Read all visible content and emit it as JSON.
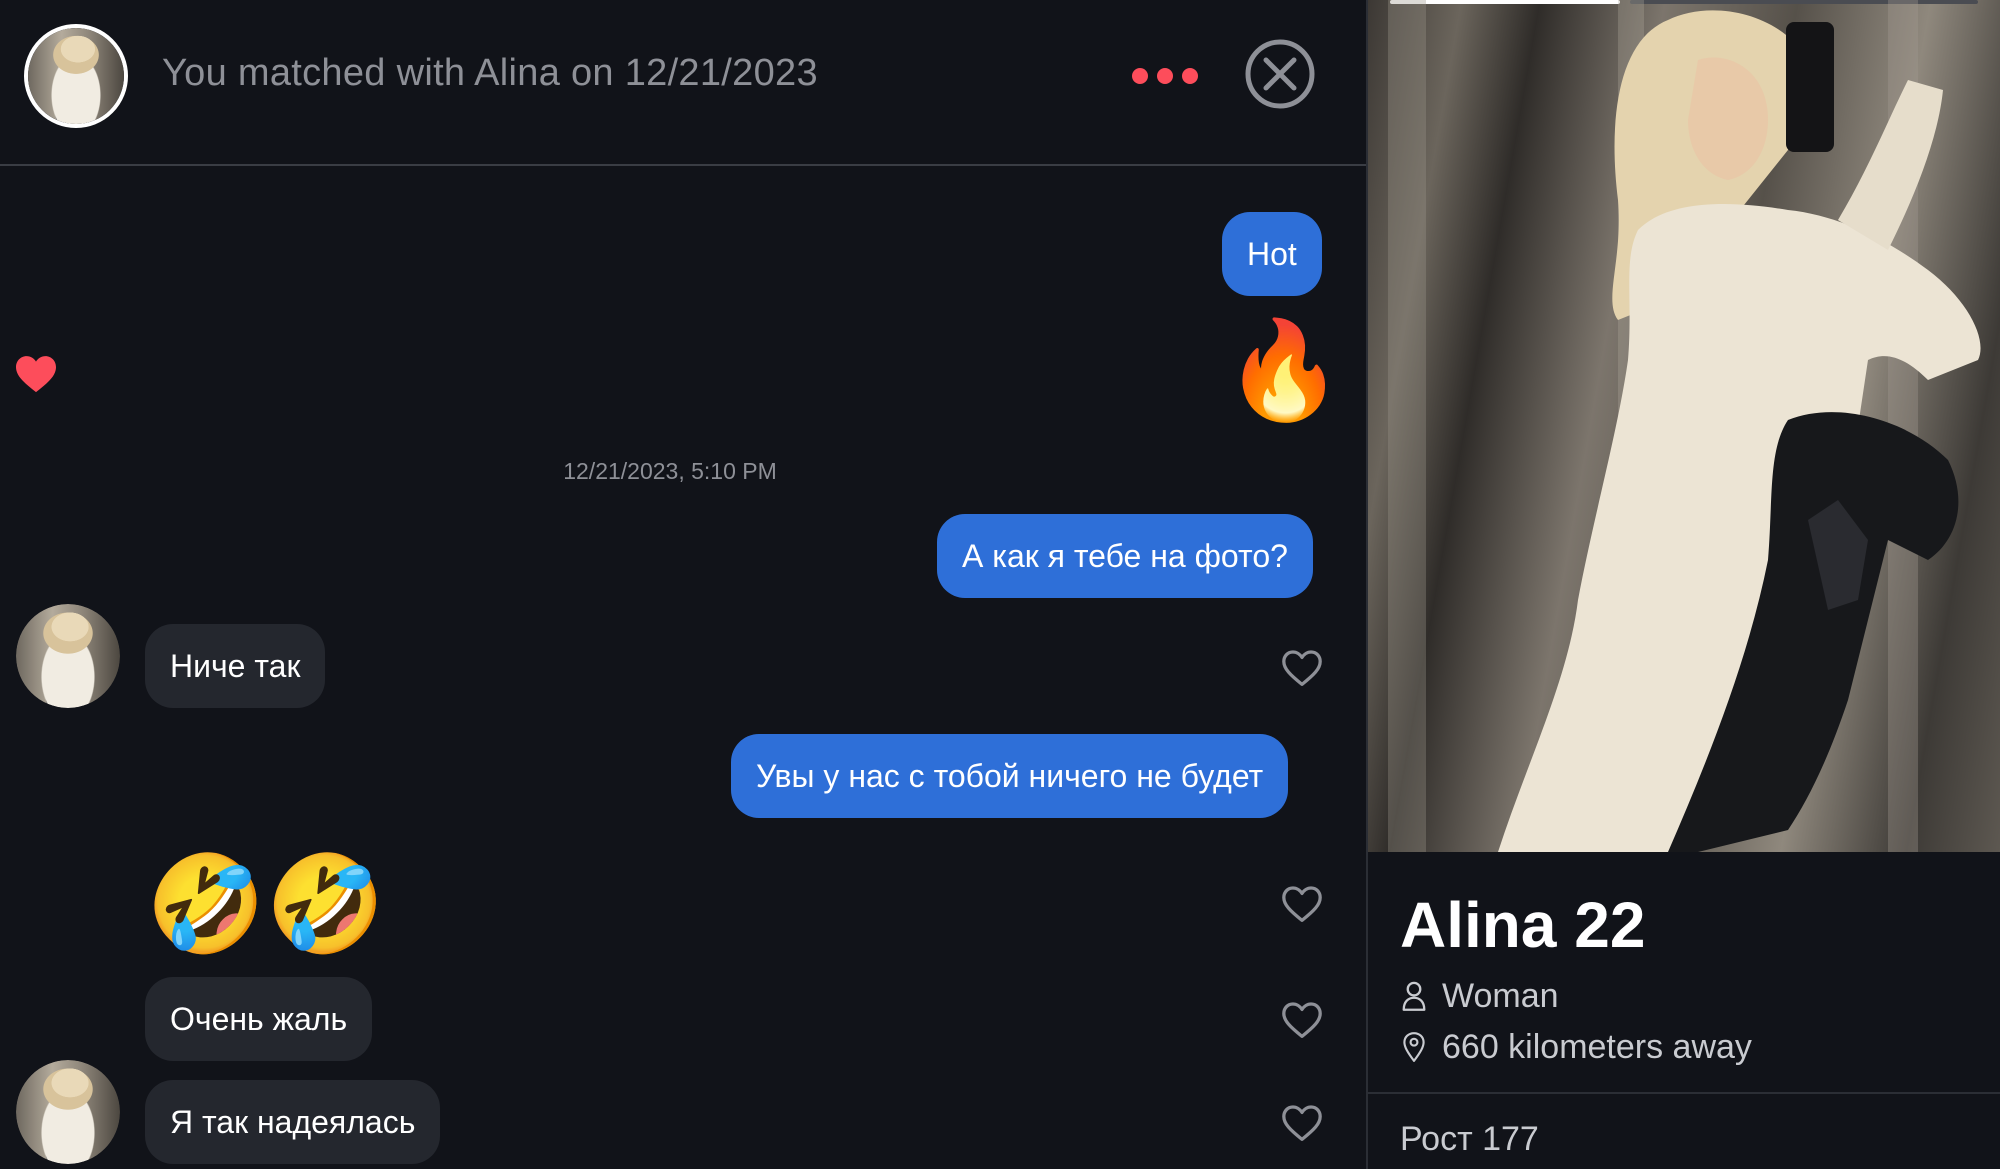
{
  "header": {
    "match_text": "You matched with Alina on 12/21/2023",
    "avatar_icon": "match-avatar"
  },
  "messages": [
    {
      "side": "sent",
      "type": "text",
      "text": "Hot"
    },
    {
      "side": "sent",
      "type": "emoji",
      "text": "🔥"
    },
    {
      "type": "timestamp",
      "text": "12/21/2023, 5:10 PM"
    },
    {
      "side": "sent",
      "type": "text",
      "text": "А как я тебе на фото?"
    },
    {
      "side": "received",
      "type": "text",
      "text": "Ниче так"
    },
    {
      "side": "sent",
      "type": "text",
      "text": "Увы у нас с тобой ничего не будет"
    },
    {
      "side": "received",
      "type": "emoji",
      "text": "🤣🤣"
    },
    {
      "side": "received",
      "type": "text",
      "text": "Очень жаль"
    },
    {
      "side": "received",
      "type": "text",
      "text": "Я так надеялась"
    }
  ],
  "profile": {
    "name_age": "Alina 22",
    "gender": "Woman",
    "distance": "660 kilometers away",
    "height": "Рост 177",
    "photo_index": 1,
    "photo_count": 2
  },
  "colors": {
    "background": "#111319",
    "sent_bubble": "#2e6fd8",
    "received_bubble": "#24272e",
    "accent": "#fd4d5b",
    "muted_text": "#8e9097"
  }
}
